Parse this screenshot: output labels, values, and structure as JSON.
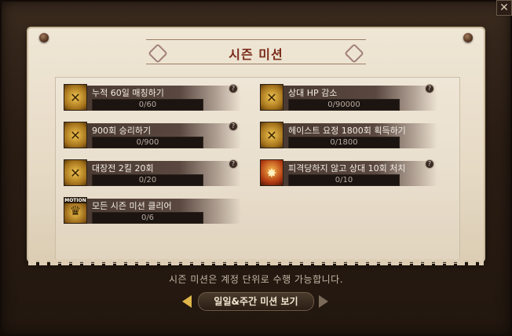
{
  "window": {
    "close_label": "✕"
  },
  "title": "시즌 미션",
  "missions": [
    {
      "label": "누적 60일 매칭하기",
      "progress": "0/60",
      "icon": "crossed-swords-badge-icon"
    },
    {
      "label": "상대 HP 감소",
      "progress": "0/90000",
      "icon": "crossed-swords-badge-icon"
    },
    {
      "label": "900회 승리하기",
      "progress": "0/900",
      "icon": "crossed-swords-badge-icon"
    },
    {
      "label": "헤이스트 요정 1800회 획득하기",
      "progress": "0/1800",
      "icon": "crossed-swords-badge-icon"
    },
    {
      "label": "대장전 2킬 20회",
      "progress": "0/20",
      "icon": "crossed-swords-badge-icon"
    },
    {
      "label": "피격당하지 않고 상대 10회 처치",
      "progress": "0/10",
      "icon": "fire-strike-icon"
    },
    {
      "label": "모든 시즌 미션 클리어",
      "progress": "0/6",
      "icon": "trophy-icon",
      "tag": "MOTION"
    }
  ],
  "help_label": "?",
  "footer": {
    "note": "시즌 미션은 계정 단위로 수행 가능합니다."
  },
  "nav": {
    "button_label": "일일&주간 미션 보기"
  },
  "colors": {
    "title": "#7a2a1a",
    "accent_gold": "#e0b64a",
    "parchment": "#e6dac5"
  }
}
